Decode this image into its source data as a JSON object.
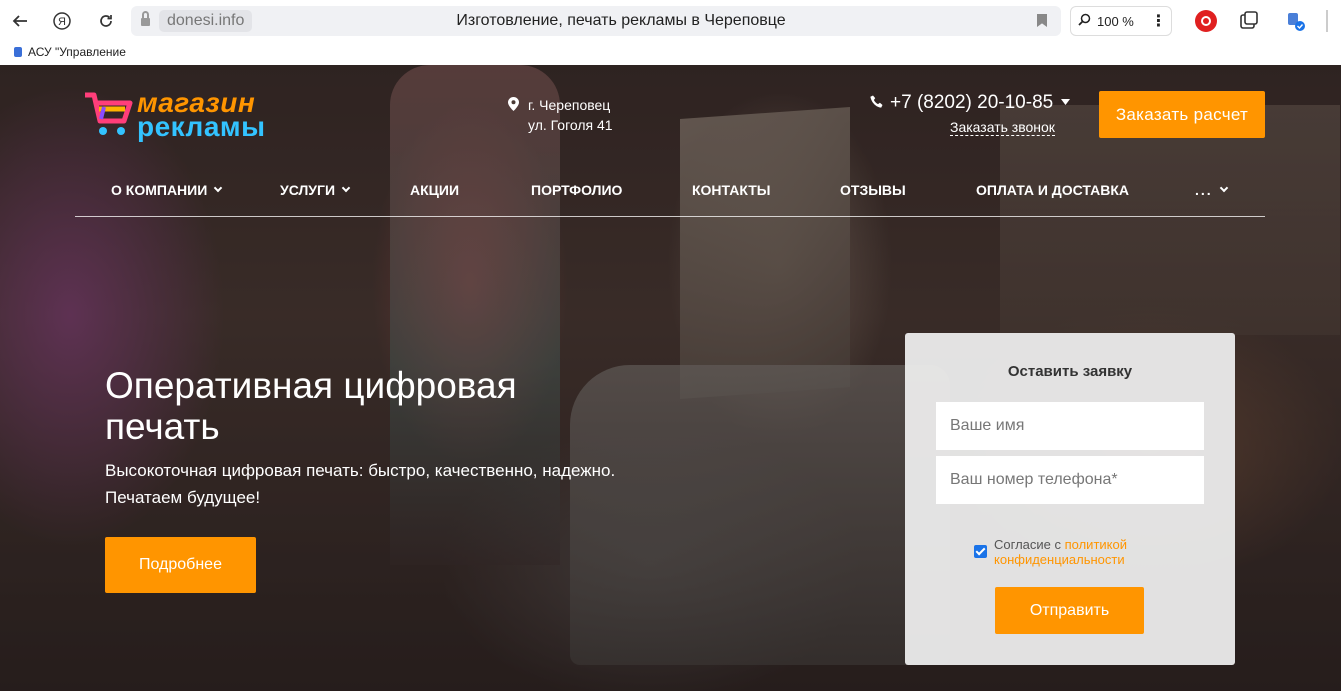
{
  "browser": {
    "domain": "donesi.info",
    "title": "Изготовление, печать рекламы в Череповце",
    "zoom": "100 %",
    "bookmark_label": "АСУ \"Управление"
  },
  "header": {
    "logo_line1": "магазин",
    "logo_line2": "рекламы",
    "city": "г. Череповец",
    "street": "ул. Гоголя 41",
    "phone": "+7 (8202) 20-10-85",
    "callback": "Заказать звонок",
    "order_button": "Заказать расчет"
  },
  "nav": {
    "items": [
      {
        "label": "О КОМПАНИИ"
      },
      {
        "label": "УСЛУГИ"
      },
      {
        "label": "АКЦИИ"
      },
      {
        "label": "ПОРТФОЛИО"
      },
      {
        "label": "КОНТАКТЫ"
      },
      {
        "label": "ОТЗЫВЫ"
      },
      {
        "label": "ОПЛАТА И ДОСТАВКА"
      },
      {
        "label": "..."
      }
    ]
  },
  "hero": {
    "title": "Оперативная цифровая печать",
    "subtitle_line1": "Высокоточная цифровая печать: быстро, качественно, надежно.",
    "subtitle_line2": "Печатаем будущее!",
    "more_button": "Подробнее"
  },
  "form": {
    "title": "Оставить заявку",
    "name_placeholder": "Ваше имя",
    "phone_placeholder": "Ваш номер телефона*",
    "consent_text": "Согласие с ",
    "consent_link": "политикой конфиденциальности",
    "consent_checked": true,
    "submit": "Отправить"
  },
  "colors": {
    "accent": "#ff9500",
    "logo_blue": "#33c3ff",
    "checkbox": "#1a73e8"
  }
}
